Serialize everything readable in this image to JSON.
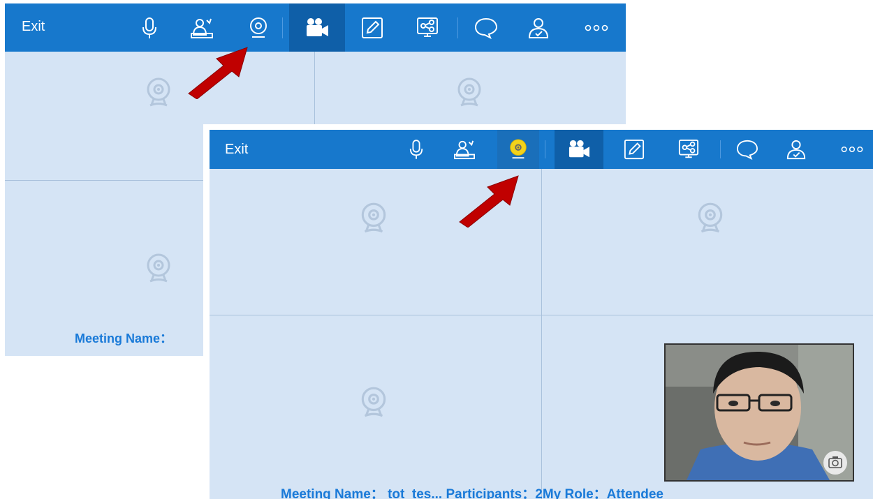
{
  "back_window": {
    "exit_label": "Exit",
    "meeting_info": "Meeting Name："
  },
  "front_window": {
    "exit_label": "Exit",
    "meeting_info": "Meeting Name： tot_tes... Participants：2My Role：Attendee"
  },
  "toolbar_icons": [
    "microphone-icon",
    "attendee-icon",
    "webcam-icon",
    "video-camera-icon",
    "whiteboard-icon",
    "screen-share-icon",
    "chat-icon",
    "participants-icon",
    "more-icon"
  ],
  "colors": {
    "toolbar": "#1778cc",
    "toolbar_active": "#0f5fa8",
    "panel": "#d5e4f5",
    "cam_icon": "#b3c6dc",
    "webcam_on": "#f2d21b",
    "info_text": "#1a7ad8",
    "arrow": "#c00000"
  }
}
